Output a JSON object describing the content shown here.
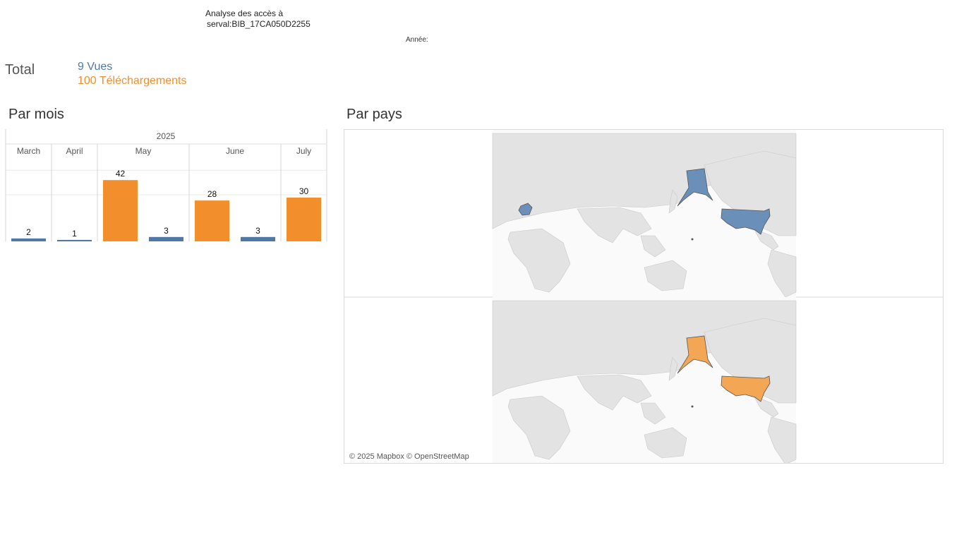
{
  "header": {
    "title_line1": "Analyse des accès à",
    "title_line2": "serval:BIB_17CA050D2255",
    "year_label": "Année:"
  },
  "totals": {
    "label": "Total",
    "views_count": "9",
    "views_label": "Vues",
    "downloads_count": "100",
    "downloads_label": "Téléchargements"
  },
  "sections": {
    "by_month": "Par mois",
    "by_country": "Par pays"
  },
  "colors": {
    "views": "#4e79a7",
    "downloads": "#f28e2b",
    "map_views": "#6a8fb8",
    "map_downloads": "#f3a654",
    "land": "#e3e3e3",
    "border": "#c9c9c9",
    "grid": "#e8e8e8",
    "header_text": "#555555"
  },
  "chart_data": {
    "type": "bar",
    "year": "2025",
    "categories": [
      "March",
      "April",
      "May",
      "June",
      "July"
    ],
    "series": [
      {
        "name": "Vues",
        "values": [
          2,
          1,
          3,
          3,
          null
        ]
      },
      {
        "name": "Téléchargements",
        "values": [
          null,
          null,
          42,
          28,
          30
        ]
      }
    ],
    "ylim": [
      0,
      45
    ],
    "grid": true
  },
  "map": {
    "attribution": "© 2025 Mapbox © OpenStreetMap",
    "panels": [
      {
        "measure": "Vues",
        "highlighted": [
          "France",
          "United States"
        ]
      },
      {
        "measure": "Téléchargements",
        "highlighted": [
          "United States"
        ]
      }
    ]
  }
}
